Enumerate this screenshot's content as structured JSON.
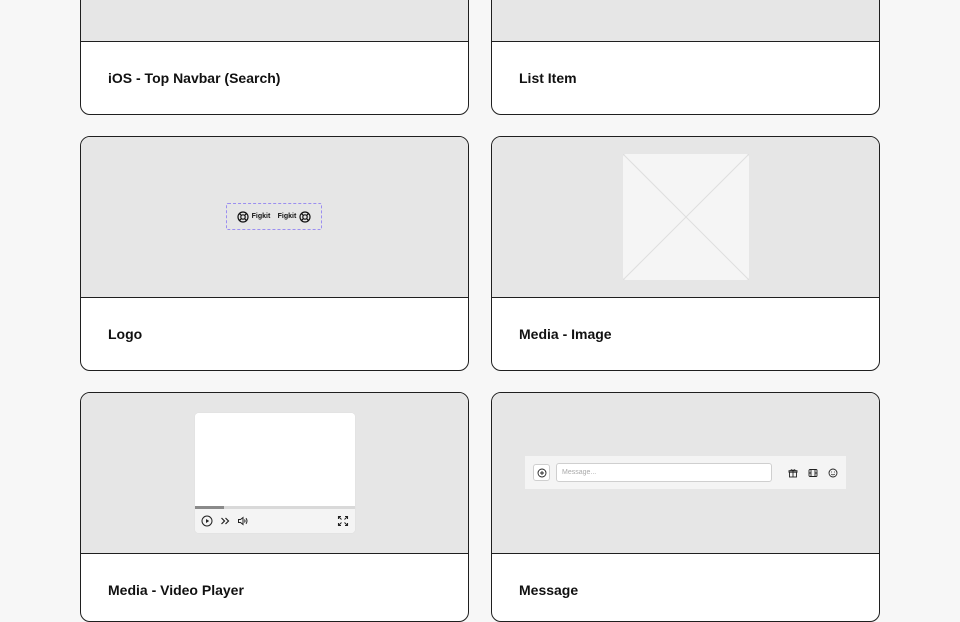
{
  "cards": [
    {
      "label": "iOS - Top Navbar (Search)"
    },
    {
      "label": "List Item"
    },
    {
      "label": "Logo",
      "logo_text_left": "Figkit",
      "logo_text_right": "Figkit"
    },
    {
      "label": "Media - Image"
    },
    {
      "label": "Media - Video Player",
      "progress": 0.18
    },
    {
      "label": "Message",
      "placeholder": "Message..."
    }
  ],
  "colors": {
    "background": "#f7f7f7",
    "preview": "#e6e6e6",
    "border": "#1f1f1f",
    "selection_dash": "#9b8ef0"
  }
}
